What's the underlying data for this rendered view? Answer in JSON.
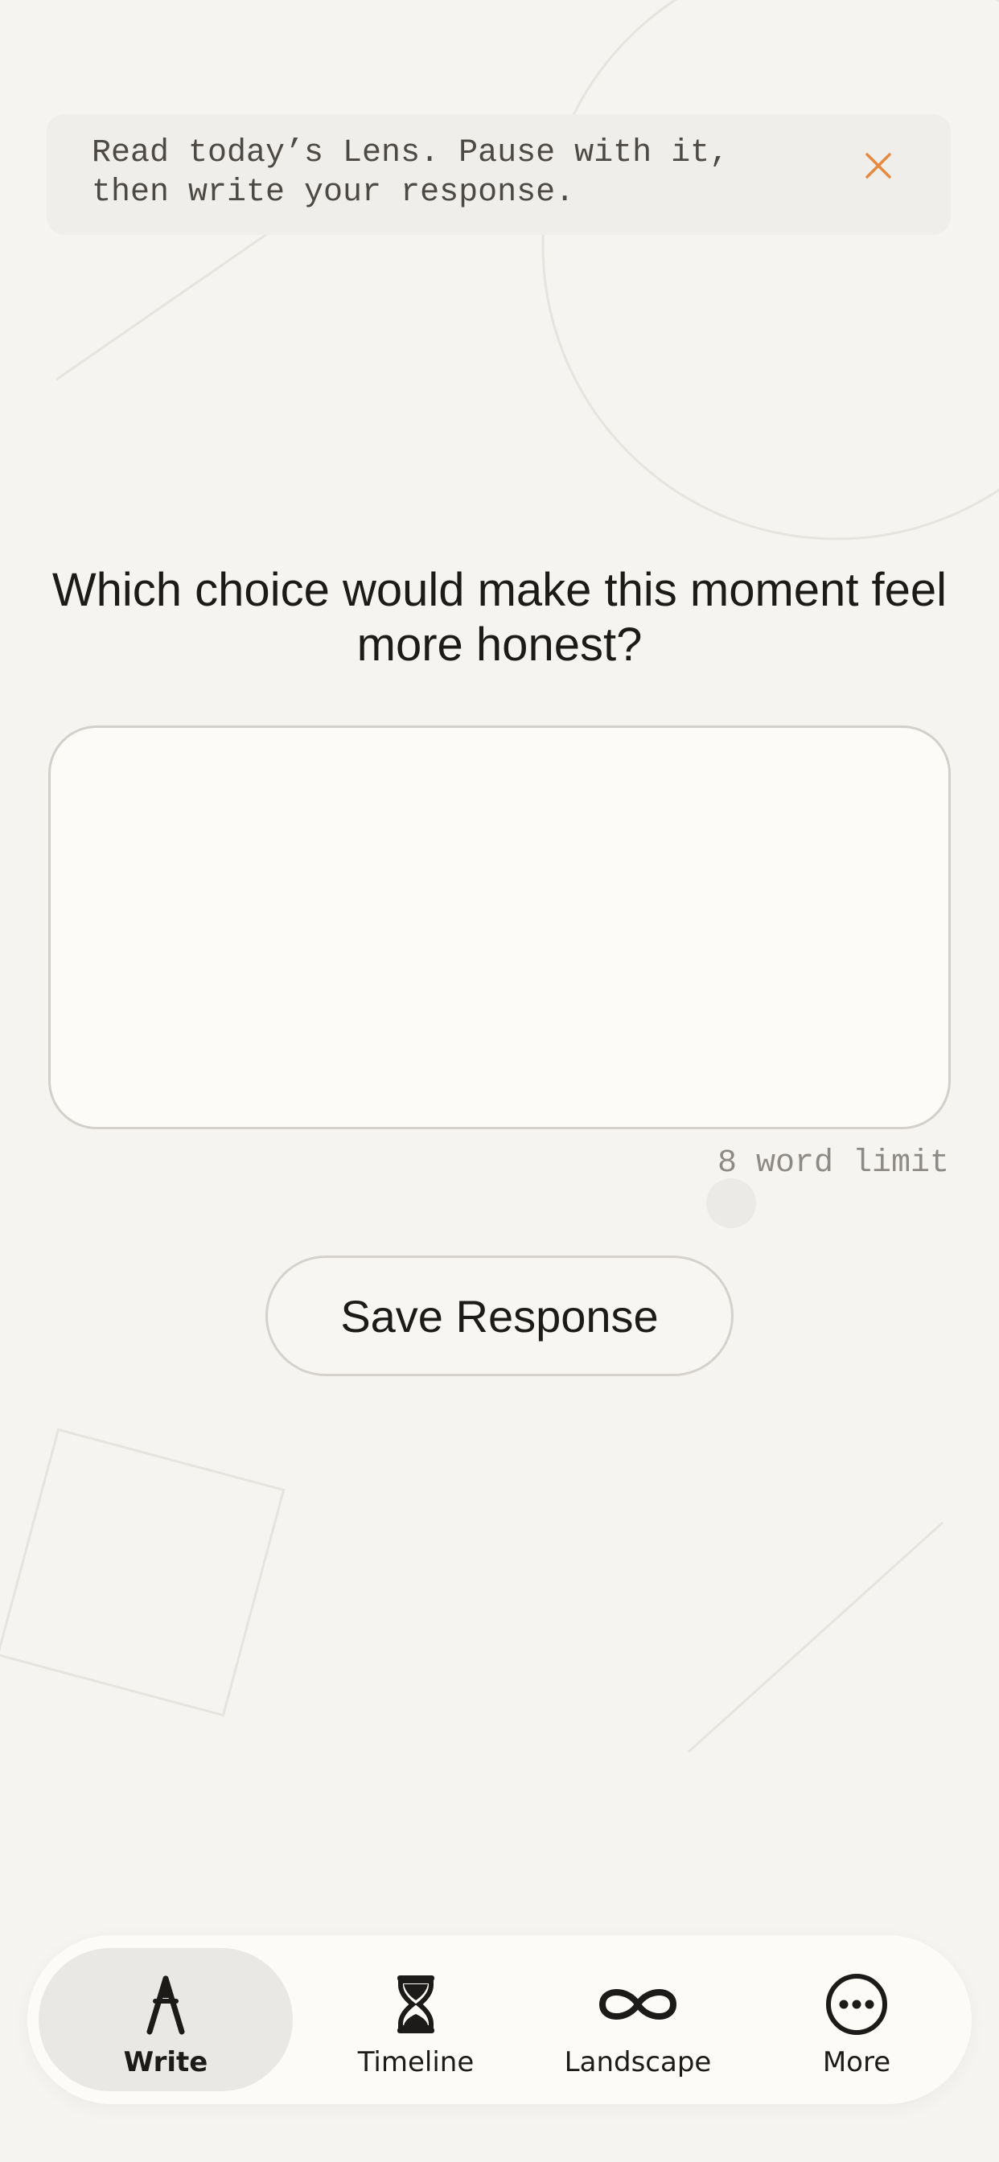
{
  "banner": {
    "message": "Read today’s Lens. Pause with it,\nthen write your response.",
    "close_icon": "close-icon",
    "accent_color": "#e8893f"
  },
  "prompt": {
    "question": "Which choice would make this moment feel more honest?"
  },
  "response": {
    "value": "",
    "placeholder": ""
  },
  "word_limit": {
    "label": "8 word limit"
  },
  "save_button": {
    "label": "Save Response"
  },
  "tabbar": {
    "items": [
      {
        "label": "Write",
        "icon": "compass-icon",
        "active": true
      },
      {
        "label": "Timeline",
        "icon": "hourglass-icon",
        "active": false
      },
      {
        "label": "Landscape",
        "icon": "infinity-icon",
        "active": false
      },
      {
        "label": "More",
        "icon": "more-icon",
        "active": false
      }
    ]
  }
}
